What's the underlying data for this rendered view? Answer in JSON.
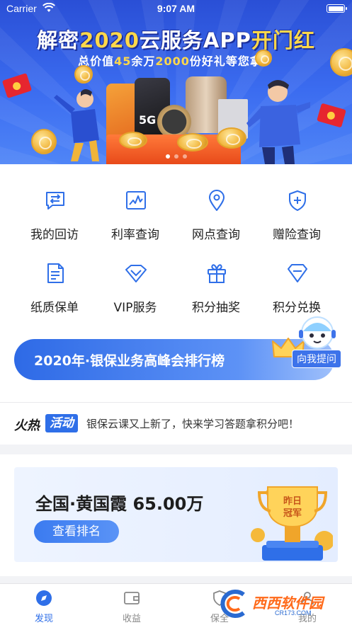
{
  "status_bar": {
    "carrier": "Carrier",
    "time": "9:07 AM"
  },
  "banner": {
    "title_prefix": "解密",
    "title_highlight": "2020",
    "title_middle": "云服务APP",
    "title_suffix": "开门红",
    "subtitle_prefix": "总价值",
    "subtitle_num1": "45",
    "subtitle_mid": "余万",
    "subtitle_num2": "2000",
    "subtitle_suffix": "份好礼等您拿！",
    "phone_label": "5G",
    "pager_count": 3,
    "pager_active": 0
  },
  "grid": {
    "items": [
      {
        "label": "我的回访",
        "icon": "return-visit-icon"
      },
      {
        "label": "利率查询",
        "icon": "rate-chart-icon"
      },
      {
        "label": "网点查询",
        "icon": "location-pin-icon"
      },
      {
        "label": "赠险查询",
        "icon": "shield-plus-icon"
      },
      {
        "label": "纸质保单",
        "icon": "document-icon"
      },
      {
        "label": "VIP服务",
        "icon": "vip-diamond-icon"
      },
      {
        "label": "积分抽奖",
        "icon": "gift-box-icon"
      },
      {
        "label": "积分兑换",
        "icon": "exchange-diamond-icon"
      }
    ]
  },
  "rank_banner": {
    "text": "2020年·银保业务高峰会排行榜"
  },
  "helper": {
    "button_label": "向我提问"
  },
  "news": {
    "tag_part1": "火热",
    "tag_part2": "活动",
    "message": "银保云课又上新了，快来学习答题拿积分吧！"
  },
  "champion": {
    "title": "全国·黄国霞 65.00万",
    "button": "查看排名",
    "trophy_text_line1": "昨日",
    "trophy_text_line2": "冠军"
  },
  "tabbar": {
    "tabs": [
      {
        "label": "发现",
        "active": true
      },
      {
        "label": "收益",
        "active": false
      },
      {
        "label": "保全",
        "active": false
      },
      {
        "label": "我的",
        "active": false
      }
    ]
  },
  "watermark": {
    "text": "西西软件园",
    "sub": "CR173.COM"
  },
  "colors": {
    "primary": "#2f6fe8",
    "banner": "#3b6cf0",
    "gold": "#ffd84a"
  }
}
